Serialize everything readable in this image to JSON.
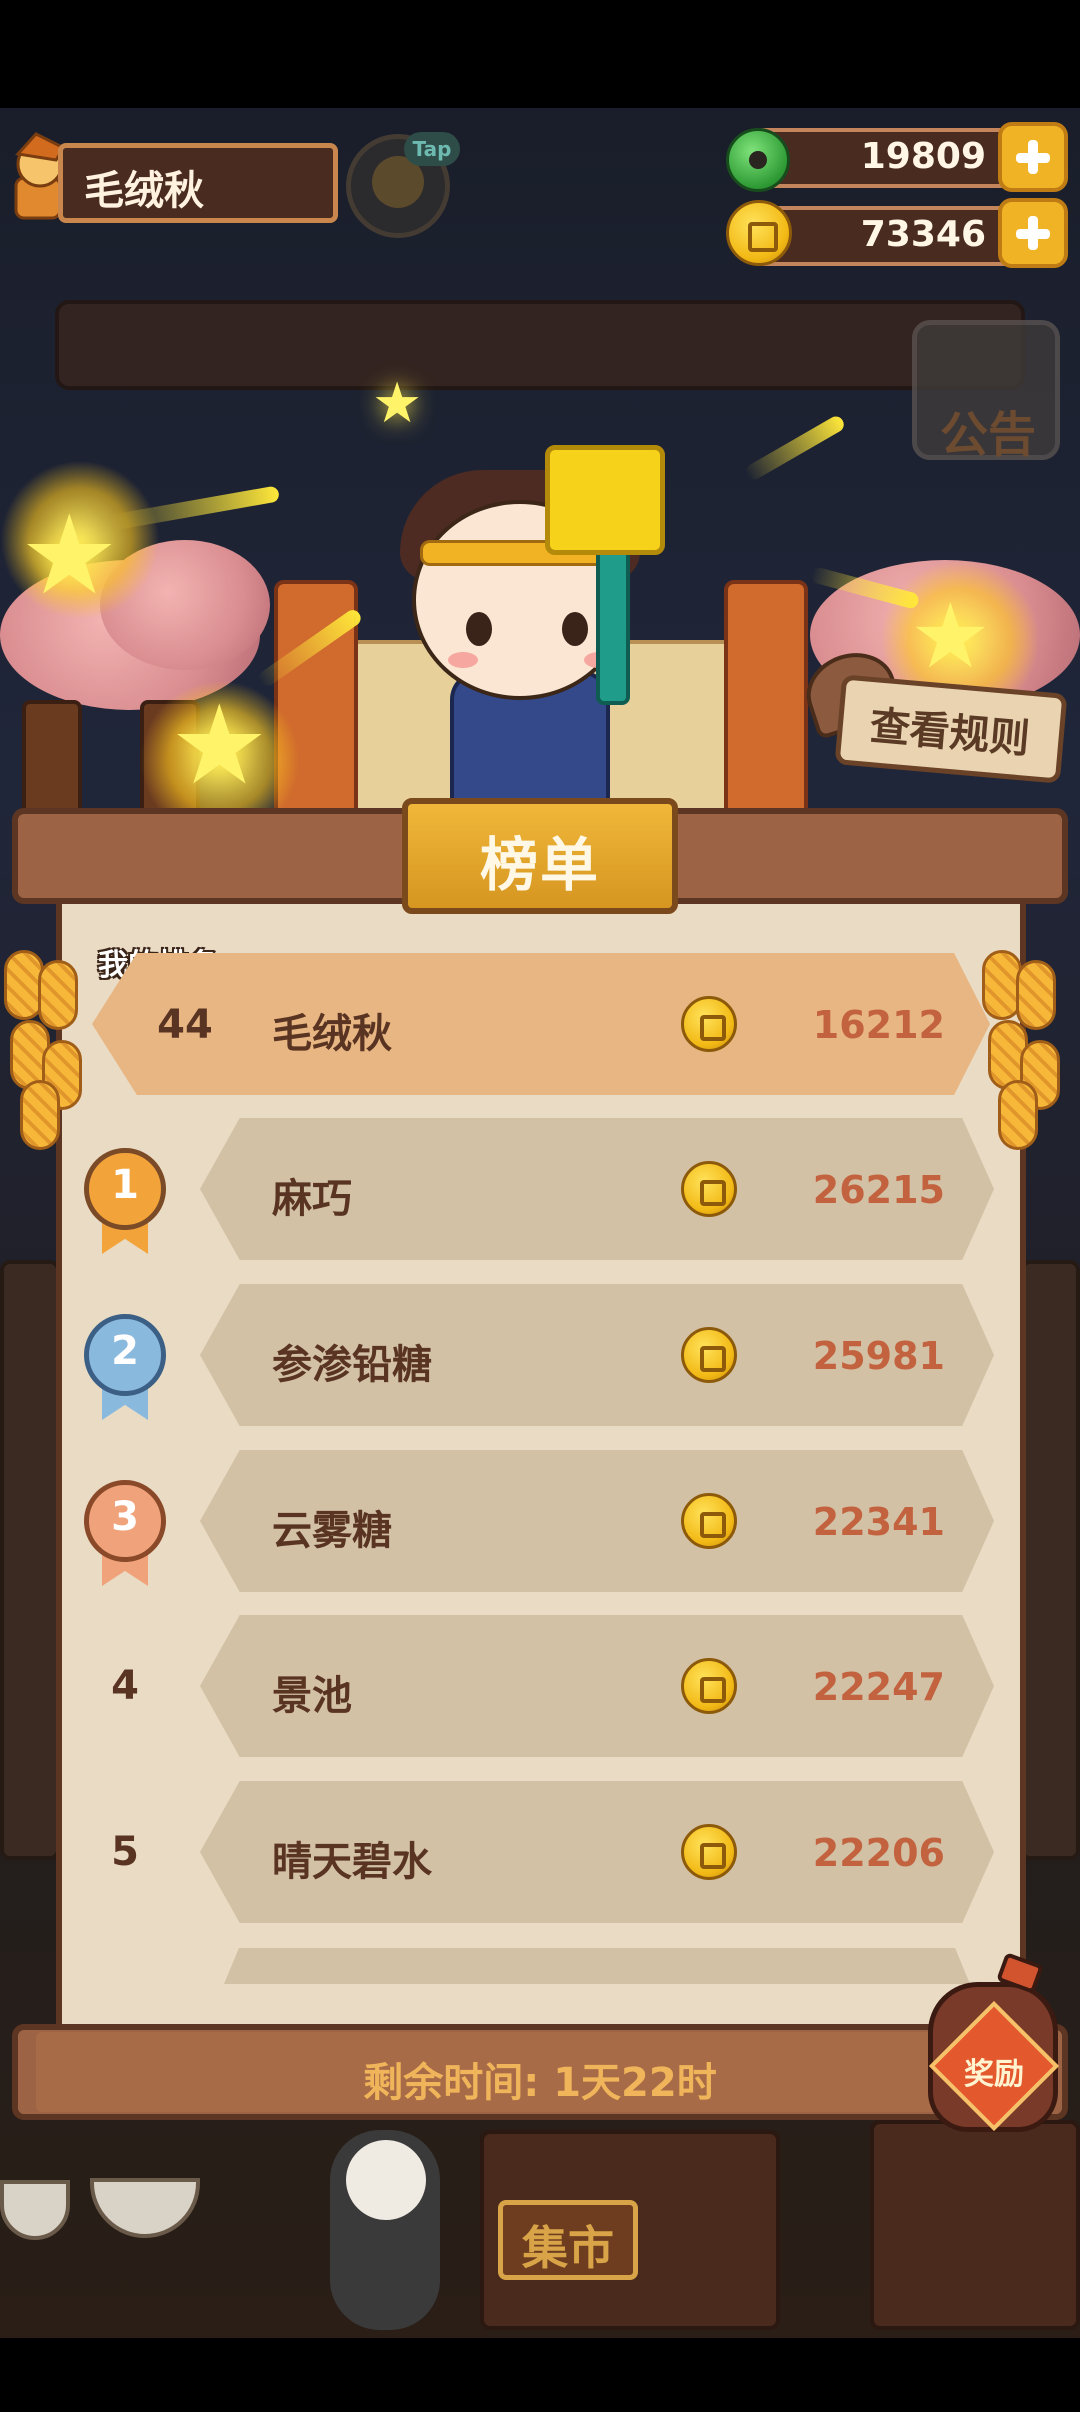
{
  "player": {
    "name": "毛绒秋"
  },
  "hud": {
    "tap_label": "Tap",
    "jade_count": "19809",
    "coin_count": "73346"
  },
  "notice": {
    "label": "公告"
  },
  "rules_button": {
    "label": "查看规则"
  },
  "leaderboard": {
    "title": "榜单",
    "my_rank_label": "我的排名",
    "my_entry": {
      "rank": "44",
      "name": "毛绒秋",
      "score": "16212"
    },
    "entries": [
      {
        "rank": "1",
        "name": "麻巧",
        "score": "26215"
      },
      {
        "rank": "2",
        "name": "参渗铅糖",
        "score": "25981"
      },
      {
        "rank": "3",
        "name": "云雾糖",
        "score": "22341"
      },
      {
        "rank": "4",
        "name": "景池",
        "score": "22247"
      },
      {
        "rank": "5",
        "name": "晴天碧水",
        "score": "22206"
      }
    ],
    "timer": "剩余时间: 1天22时",
    "reward_label": "奖励"
  },
  "scene": {
    "market_label": "集市"
  },
  "colors": {
    "medal_gold": "#f2a43a",
    "medal_silver": "#8ab9de",
    "medal_bronze": "#f0a27a",
    "score": "#c2623e",
    "panel": "#eadbc4"
  },
  "icons": {
    "jade": "jade-icon",
    "coin": "coin-icon",
    "plus": "plus-icon",
    "medal": "medal-icon",
    "reward_jar": "reward-jar-icon"
  }
}
